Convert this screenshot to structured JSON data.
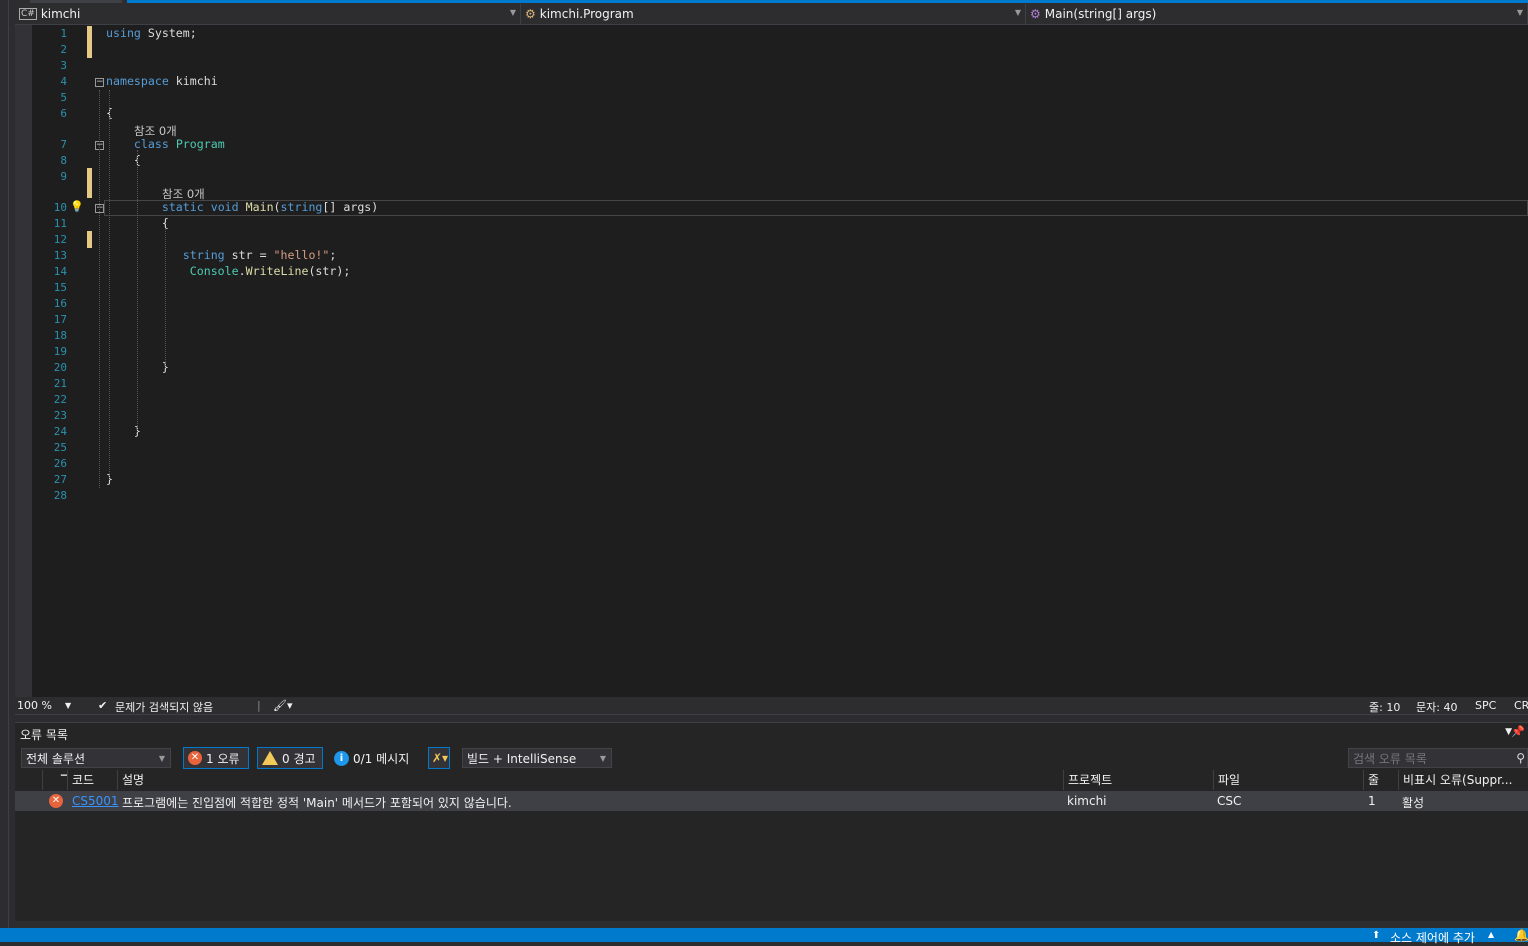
{
  "nav": {
    "project": "kimchi",
    "project_icon": "C#",
    "type": "kimchi.Program",
    "member": "Main(string[] args)"
  },
  "code": {
    "codelens": "참조 0개",
    "lines": [
      {
        "n": "1",
        "tokens": [
          [
            "kw",
            "using"
          ],
          [
            "pl",
            " System;"
          ]
        ]
      },
      {
        "n": "2",
        "tokens": []
      },
      {
        "n": "3",
        "tokens": []
      },
      {
        "n": "4",
        "tokens": [
          [
            "kw",
            "namespace"
          ],
          [
            "pl",
            " kimchi"
          ]
        ]
      },
      {
        "n": "5",
        "tokens": []
      },
      {
        "n": "6",
        "tokens": [
          [
            "pl",
            "{"
          ]
        ]
      },
      {
        "n": "7",
        "lens": true,
        "tokens": [
          [
            "pl",
            "    "
          ],
          [
            "kw",
            "class"
          ],
          [
            "pl",
            " "
          ],
          [
            "ty",
            "Program"
          ]
        ]
      },
      {
        "n": "8",
        "tokens": [
          [
            "pl",
            "    {"
          ]
        ]
      },
      {
        "n": "9",
        "tokens": []
      },
      {
        "n": "10",
        "lens": true,
        "tokens": [
          [
            "pl",
            "        "
          ],
          [
            "kw",
            "static"
          ],
          [
            "pl",
            " "
          ],
          [
            "kw",
            "void"
          ],
          [
            "pl",
            " "
          ],
          [
            "me",
            "Main"
          ],
          [
            "pl",
            "("
          ],
          [
            "kw",
            "string"
          ],
          [
            "pl",
            "[] args)"
          ]
        ]
      },
      {
        "n": "11",
        "tokens": [
          [
            "pl",
            "        {"
          ]
        ]
      },
      {
        "n": "12",
        "tokens": []
      },
      {
        "n": "13",
        "tokens": [
          [
            "pl",
            "           "
          ],
          [
            "kw",
            "string"
          ],
          [
            "pl",
            " str = "
          ],
          [
            "str",
            "\"hello!\""
          ],
          [
            "pl",
            ";"
          ]
        ]
      },
      {
        "n": "14",
        "tokens": [
          [
            "pl",
            "            "
          ],
          [
            "ty",
            "Console"
          ],
          [
            "pl",
            "."
          ],
          [
            "me",
            "WriteLine"
          ],
          [
            "pl",
            "(str);"
          ]
        ]
      },
      {
        "n": "15",
        "tokens": []
      },
      {
        "n": "16",
        "tokens": []
      },
      {
        "n": "17",
        "tokens": []
      },
      {
        "n": "18",
        "tokens": []
      },
      {
        "n": "19",
        "tokens": []
      },
      {
        "n": "20",
        "tokens": [
          [
            "pl",
            "        }"
          ]
        ]
      },
      {
        "n": "21",
        "tokens": []
      },
      {
        "n": "22",
        "tokens": []
      },
      {
        "n": "23",
        "tokens": []
      },
      {
        "n": "24",
        "tokens": [
          [
            "pl",
            "    }"
          ]
        ]
      },
      {
        "n": "25",
        "tokens": []
      },
      {
        "n": "26",
        "tokens": []
      },
      {
        "n": "27",
        "tokens": [
          [
            "pl",
            "}"
          ]
        ]
      },
      {
        "n": "28",
        "tokens": []
      }
    ]
  },
  "editor_status": {
    "zoom": "100 %",
    "issues": "문제가 검색되지 않음",
    "line": "줄: 10",
    "col": "문자: 40",
    "spc": "SPC",
    "crlf": "CR"
  },
  "error_list": {
    "title": "오류 목록",
    "scope": "전체 솔루션",
    "errors": "1 오류",
    "warnings": "0 경고",
    "messages": "0/1 메시지",
    "source": "빌드 + IntelliSense",
    "search_placeholder": "검색 오류 목록",
    "columns": {
      "code": "코드",
      "description": "설명",
      "project": "프로젝트",
      "file": "파일",
      "line": "줄",
      "suppression": "비표시 오류(Suppr..."
    },
    "rows": [
      {
        "code": "CS5001",
        "description": "프로그램에는 진입점에 적합한 정적 'Main' 메서드가 포함되어 있지 않습니다.",
        "project": "kimchi",
        "file": "CSC",
        "line": "1",
        "suppression": "활성"
      }
    ]
  },
  "statusbar": {
    "source_control": "소스 제어에 추가"
  },
  "colors": {
    "accent": "#007acc",
    "error": "#e8643c",
    "keyword": "#569cd6",
    "type": "#4ec9b0",
    "string": "#d69d85"
  }
}
